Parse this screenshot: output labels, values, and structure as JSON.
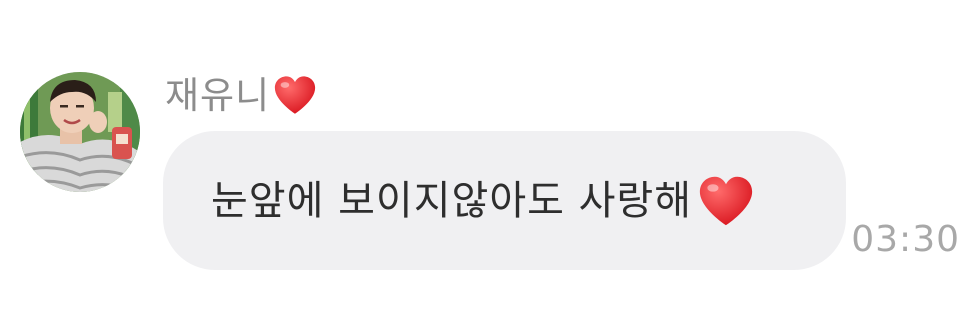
{
  "message": {
    "sender_name": "재유니",
    "sender_emoji": "❤️",
    "text": "눈앞에 보이지않아도 사랑해",
    "text_emoji": "❤️",
    "time": "03:30"
  },
  "colors": {
    "bubble_background": "#f0f0f2",
    "heart": "#e3262e",
    "sender_text": "#8c8c8c",
    "timestamp_text": "#a8a8a8"
  }
}
